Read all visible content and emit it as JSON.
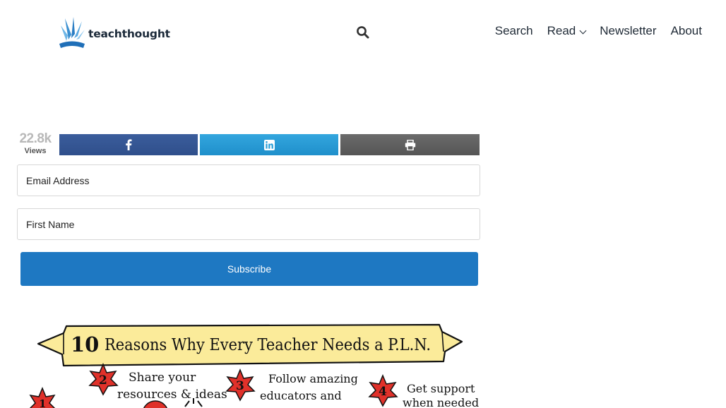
{
  "header": {
    "brand": "teachthought",
    "nav": [
      {
        "label": "Search"
      },
      {
        "label": "Read"
      },
      {
        "label": "Newsletter"
      },
      {
        "label": "About"
      }
    ]
  },
  "share_bar": {
    "views_count": "22.8k",
    "views_label": "Views",
    "buttons": [
      "facebook-icon",
      "linkedin-icon",
      "print-icon"
    ],
    "colors": {
      "facebook": "#3b5998",
      "linkedin": "#2a9fd8",
      "print": "#616161"
    }
  },
  "subscribe_form": {
    "email_placeholder": "Email Address",
    "first_name_placeholder": "First Name",
    "button_label": "Subscribe",
    "accent": "#1e78c2"
  },
  "hero_image": {
    "title": "10 Reasons Why Every Teacher Needs a P.L.N.",
    "title_number": "10",
    "title_rest": "Reasons Why Every Teacher Needs a P.L.N.",
    "items": [
      {
        "num": "1",
        "lines": []
      },
      {
        "num": "2",
        "lines": [
          "Share your",
          "resources & ideas"
        ]
      },
      {
        "num": "3",
        "lines": [
          "Follow amazing",
          "educators and"
        ]
      },
      {
        "num": "4",
        "lines": [
          "Get support",
          "when needed"
        ]
      }
    ]
  }
}
